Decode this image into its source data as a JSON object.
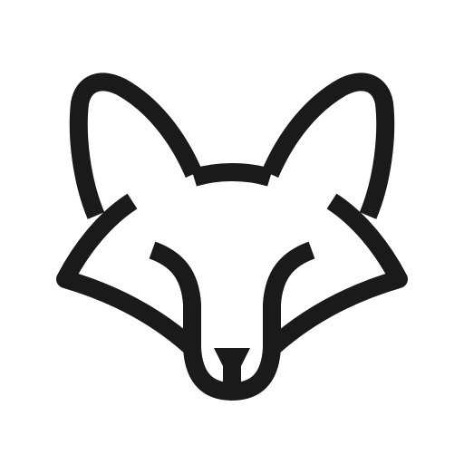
{
  "icon": {
    "name": "fox-head-icon",
    "line_color": "#1a1a1a",
    "background_color": "#ffffff"
  }
}
